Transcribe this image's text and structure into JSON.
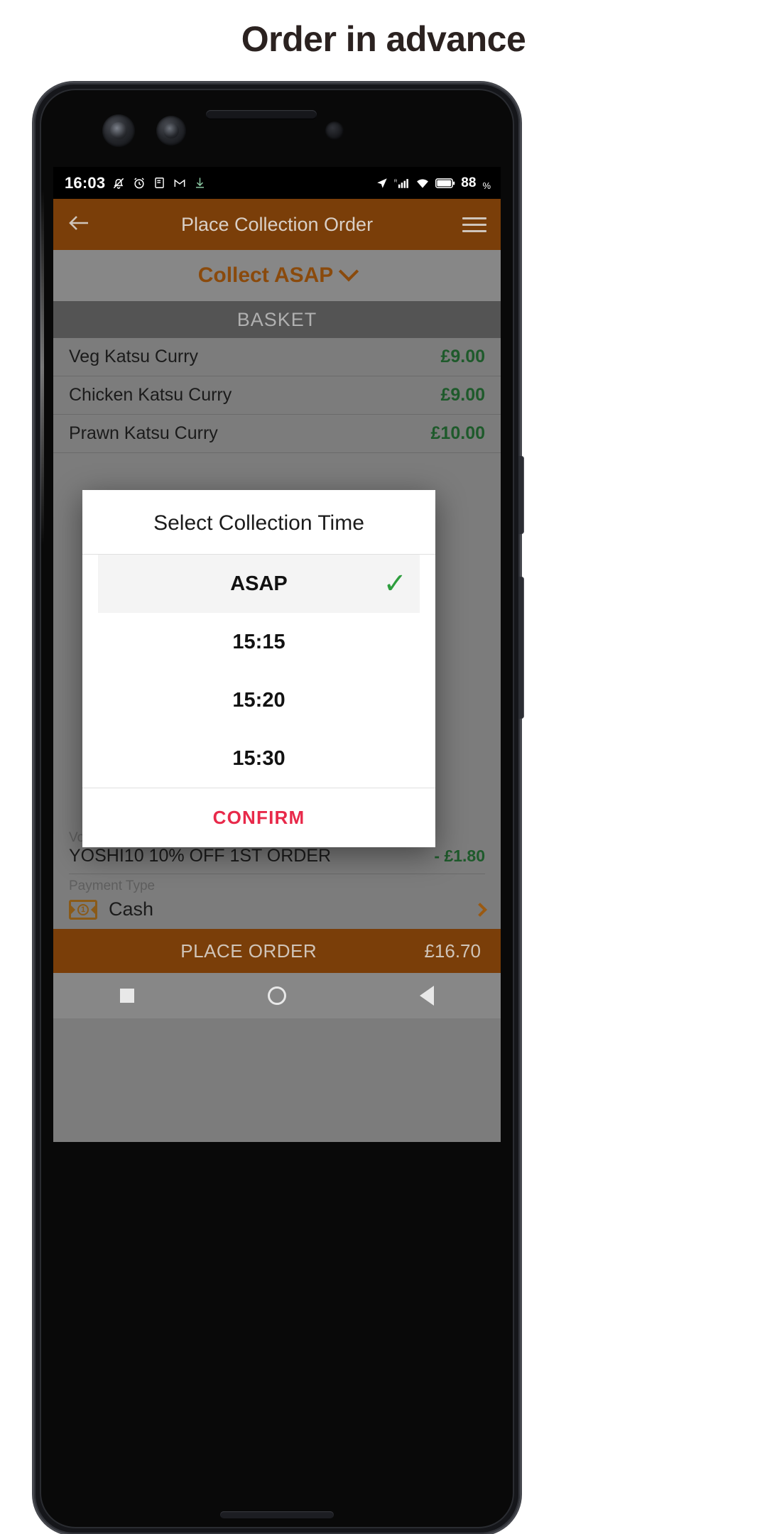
{
  "page": {
    "title": "Order in advance"
  },
  "status_bar": {
    "time": "16:03",
    "left_icons": [
      "bell-off-icon",
      "alarm-icon",
      "document-icon",
      "gmail-icon",
      "download-icon"
    ],
    "right_icons": [
      "location-arrow-icon",
      "signal-r-icon",
      "wifi-icon",
      "battery-icon"
    ],
    "battery_level": "88",
    "battery_unit": "%"
  },
  "app_bar": {
    "title": "Place Collection Order",
    "back_icon": "arrow-left-icon",
    "menu_icon": "hamburger-icon"
  },
  "collect_bar": {
    "label": "Collect ASAP",
    "chevron": "chevron-down-icon"
  },
  "basket": {
    "header": "BASKET",
    "items": [
      {
        "name": "Veg Katsu Curry",
        "price": "£9.00"
      },
      {
        "name": "Chicken Katsu Curry",
        "price": "£9.00"
      },
      {
        "name": "Prawn Katsu Curry",
        "price": "£10.00"
      }
    ]
  },
  "voucher": {
    "label": "Voucher applied",
    "code": "YOSHI10 10% OFF 1ST ORDER",
    "amount": "- £1.80"
  },
  "payment": {
    "label": "Payment Type",
    "value": "Cash",
    "icon": "cash-note-icon",
    "chevron": "chevron-right-icon"
  },
  "place_order": {
    "label": "PLACE ORDER",
    "total": "£16.70"
  },
  "nav_bar": {
    "recents": "square-icon",
    "home": "circle-icon",
    "back": "triangle-back-icon"
  },
  "dialog": {
    "title": "Select Collection Time",
    "options": [
      {
        "label": "ASAP",
        "selected": true
      },
      {
        "label": "15:15",
        "selected": false
      },
      {
        "label": "15:20",
        "selected": false
      },
      {
        "label": "15:30",
        "selected": false
      }
    ],
    "check_icon": "✓",
    "confirm": "CONFIRM"
  },
  "colors": {
    "brand_brown": "#7a3e09",
    "accent_brown": "#8a4a0c",
    "price_green": "#1e5a2b",
    "confirm_red": "#e8294a",
    "check_green": "#2e9e3e"
  }
}
